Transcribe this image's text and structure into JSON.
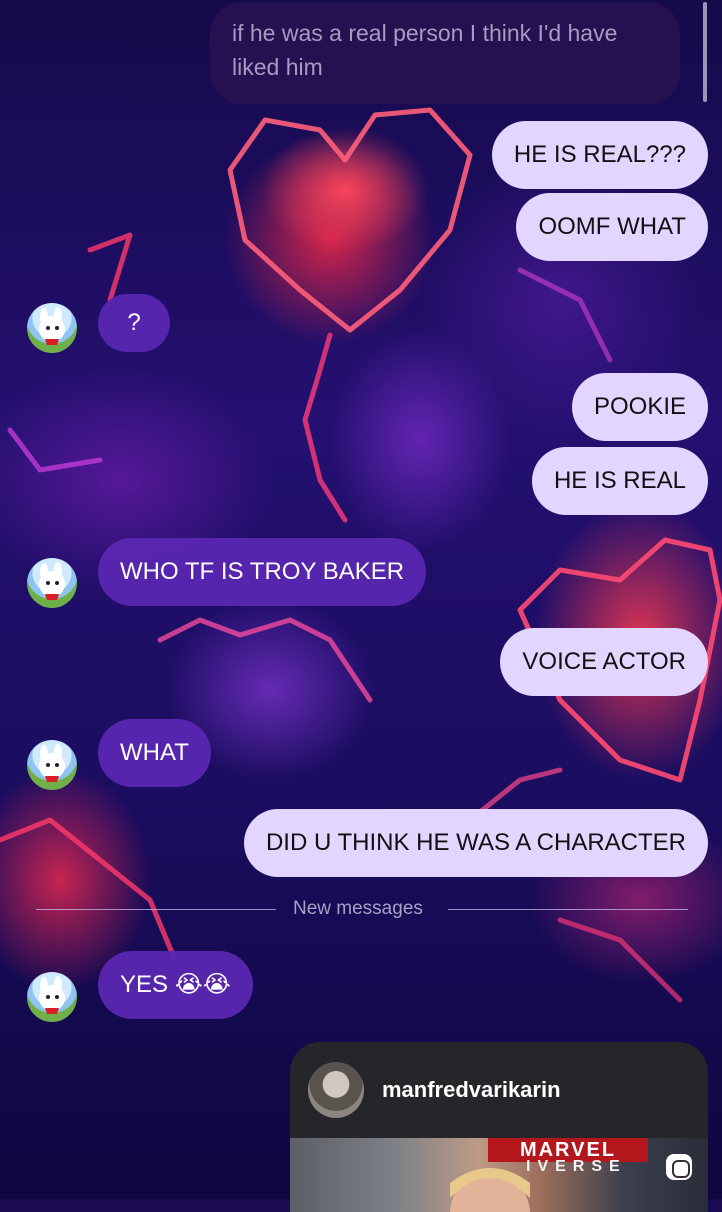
{
  "conversation": {
    "first_message": "if he was a real person I think I'd have liked him",
    "messages": [
      {
        "text": "HE IS REAL???",
        "sender": "me"
      },
      {
        "text": "OOMF WHAT",
        "sender": "me"
      },
      {
        "text": "?",
        "sender": "them"
      },
      {
        "text": "POOKIE",
        "sender": "me"
      },
      {
        "text": "HE IS REAL",
        "sender": "me"
      },
      {
        "text": "WHO TF IS TROY BAKER",
        "sender": "them"
      },
      {
        "text": "VOICE ACTOR",
        "sender": "me"
      },
      {
        "text": "WHAT",
        "sender": "them"
      },
      {
        "text": "DID U THINK HE WAS A CHARACTER",
        "sender": "me"
      },
      {
        "text": "YES 😭😭",
        "sender": "them"
      }
    ],
    "new_messages_label": "New messages",
    "shared_post": {
      "username": "manfredvarikarin",
      "image_text_top": "MARVEL",
      "image_text_bottom": "IVERSE"
    }
  },
  "colors": {
    "my_bubble": "#e2d5ff",
    "their_bubble": "#5826b0",
    "background": "#1a0a52"
  },
  "icons": {
    "avatar": "dog-avatar",
    "post_action": "copy-icon"
  }
}
